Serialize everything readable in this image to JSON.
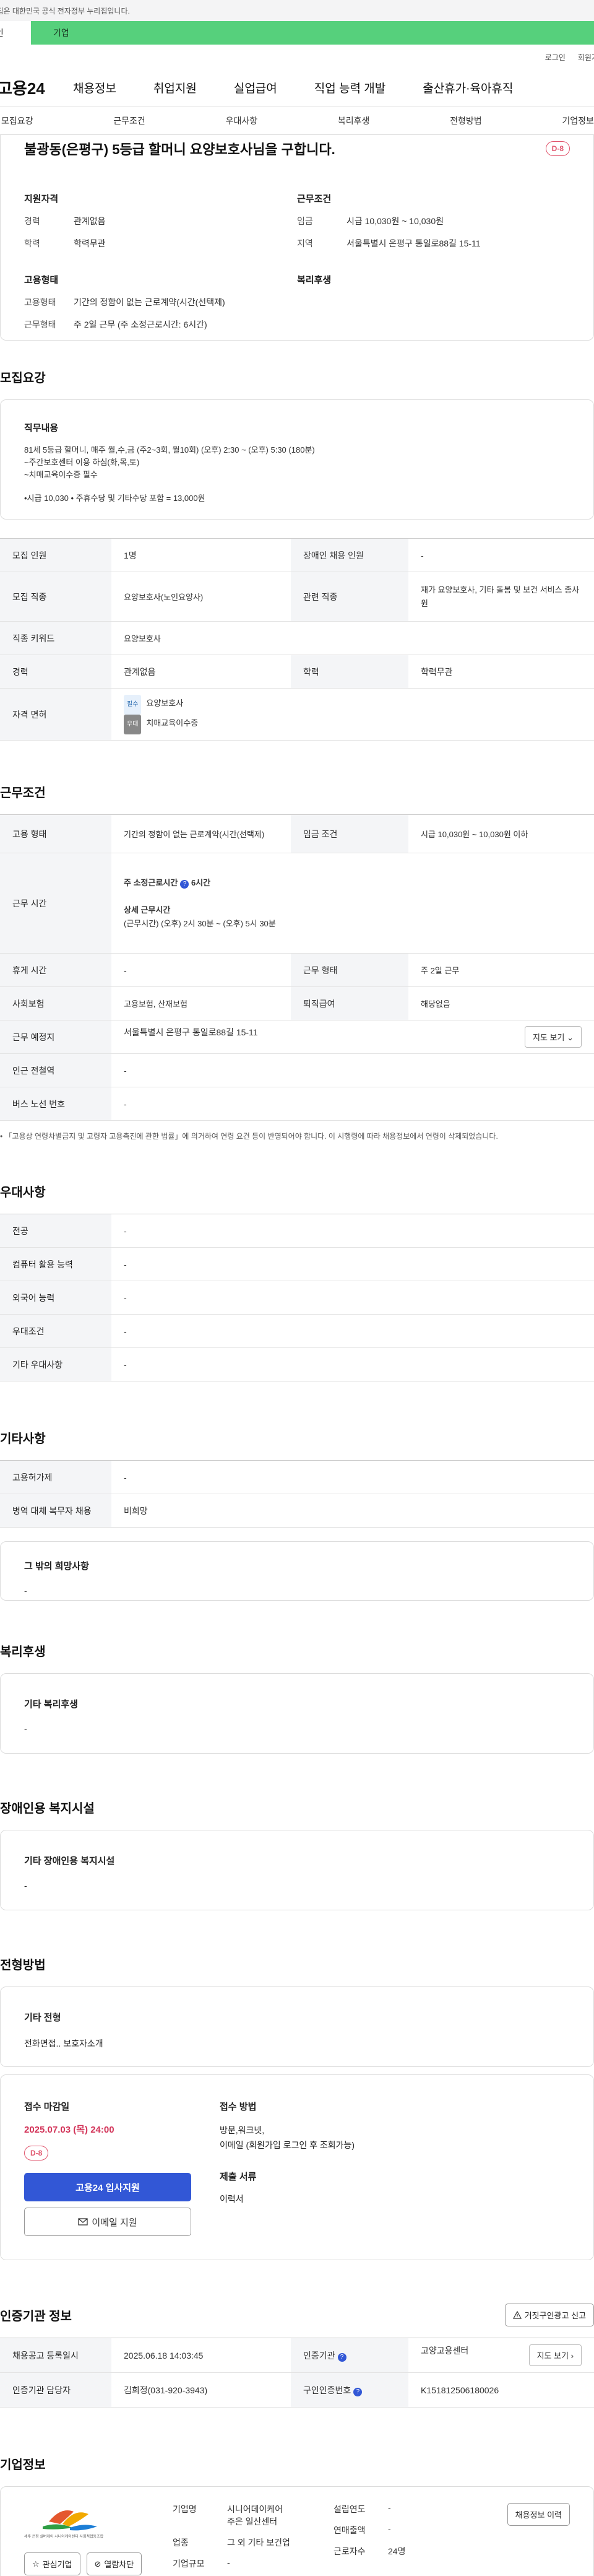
{
  "gov_banner": "이 누리집은 대한민국 공식 전자정부 누리집입니다.",
  "role_tabs": [
    "개인",
    "기업"
  ],
  "util_links": [
    "로그인",
    "회원가입"
  ],
  "logo": "고용24",
  "gnb": [
    "채용정보",
    "취업지원",
    "실업급여",
    "직업 능력 개발",
    "출산휴가·육아휴직"
  ],
  "subnav": [
    "모집요강",
    "근무조건",
    "우대사항",
    "복리후생",
    "전형방법",
    "기업정보"
  ],
  "summary": {
    "title": "불광동(은평구) 5등급 할머니 요양보호사님을 구합니다.",
    "dday": "D-8",
    "qual_h": "지원자격",
    "qual": [
      {
        "k": "경력",
        "v": "관계없음"
      },
      {
        "k": "학력",
        "v": "학력무관"
      }
    ],
    "cond_h": "근무조건",
    "cond": [
      {
        "k": "임금",
        "v": "시급 10,030원 ~ 10,030원"
      },
      {
        "k": "지역",
        "v": "서울특별시 은평구 통일로88길 15-11"
      }
    ],
    "form_h": "고용형태",
    "form": [
      {
        "k": "고용형태",
        "v": "기간의 정함이 없는 근로계약(시간(선택제)"
      },
      {
        "k": "근무형태",
        "v": "주 2일 근무 (주 소정근로시간: 6시간)"
      }
    ],
    "welfare_h": "복리후생"
  },
  "recruit": {
    "section": "모집요강",
    "duty_h": "직무내용",
    "duty_lines": [
      "81세 5등급 할머니, 매주 월,수,금 (주2~3회, 월10회) (오후) 2:30 ~ (오후) 5:30 (180분)",
      "~주간보호센터 이용 하심(화,목,토)",
      "~치매교육이수증 필수"
    ],
    "duty_pay": "•시급 10,030 • 주휴수당 및 기타수당 포함 = 13,000원",
    "rows": {
      "headcount_k": "모집 인원",
      "headcount_v": "1명",
      "disabled_k": "장애인 채용 인원",
      "disabled_v": "-",
      "job_k": "모집 직종",
      "job_v": "요양보호사(노인요양사)",
      "related_k": "관련 직종",
      "related_v": "재가 요양보호사, 기타 돌봄 및 보건 서비스 종사원",
      "keyword_k": "직종 키워드",
      "keyword_v": "요양보호사",
      "career_k": "경력",
      "career_v": "관계없음",
      "edu_k": "학력",
      "edu_v": "학력무관",
      "license_k": "자격 면허",
      "lic_req_badge": "필수",
      "lic_req": "요양보호사",
      "lic_pref_badge": "우대",
      "lic_pref": "치매교육이수증"
    }
  },
  "work": {
    "section": "근무조건",
    "type_k": "고용 형태",
    "type_v": "기간의 정함이 없는 근로계약(시간(선택제)",
    "wage_k": "임금 조건",
    "wage_v": "시급 10,030원 ~ 10,030원 이하",
    "hours_k": "근무 시간",
    "hours_week": "주 소정근로시간",
    "hours_week_v": "6시간",
    "hours_detail_h": "상세 근무시간",
    "hours_detail": "(근무시간) (오후) 2시 30분 ~ (오후) 5시 30분",
    "break_k": "휴게 시간",
    "break_v": "-",
    "form_k": "근무 형태",
    "form_v": "주 2일 근무",
    "insurance_k": "사회보험",
    "insurance_v": "고용보험, 산재보험",
    "retire_k": "퇴직급여",
    "retire_v": "해당없음",
    "place_k": "근무 예정지",
    "place_v": "서울특별시 은평구 통일로88길 15-11",
    "map_btn": "지도 보기",
    "subway_k": "인근 전철역",
    "subway_v": "-",
    "bus_k": "버스 노선 번호",
    "bus_v": "-",
    "note": "• 「고용상 연령차별금지 및 고령자 고용촉진에 관한 법률」에 의거하여 연령 요건 등이 반영되어야 합니다. 이 시행령에 따라 채용정보에서 연령이 삭제되었습니다."
  },
  "pref": {
    "section": "우대사항",
    "rows": [
      {
        "k": "전공",
        "v": "-"
      },
      {
        "k": "컴퓨터 활용 능력",
        "v": "-"
      },
      {
        "k": "외국어 능력",
        "v": "-"
      },
      {
        "k": "우대조건",
        "v": "-"
      },
      {
        "k": "기타 우대사항",
        "v": "-"
      }
    ]
  },
  "etc": {
    "section": "기타사항",
    "rows": [
      {
        "k": "고용허가제",
        "v": "-"
      },
      {
        "k": "병역 대체 복무자 채용",
        "v": "비희망"
      }
    ],
    "box_h": "그 밖의 희망사항",
    "box_v": "-"
  },
  "welfare": {
    "section": "복리후생",
    "box_h": "기타 복리후생",
    "box_v": "-"
  },
  "disabled_fac": {
    "section": "장애인용 복지시설",
    "box_h": "기타 장애인용 복지시설",
    "box_v": "-"
  },
  "screening": {
    "section": "전형방법",
    "box_h": "기타 전형",
    "box_v": "전화면접.. 보호자소개"
  },
  "apply": {
    "deadline_h": "접수 마감일",
    "deadline": "2025.07.03 (목) 24:00",
    "dday": "D-8",
    "btn_apply": "고용24 입사지원",
    "btn_email": "이메일 지원",
    "method_h": "접수 방법",
    "method_lines": [
      "방문,워크넷,",
      "이메일 (회원가입 로그인 후 조회가능)"
    ],
    "docs_h": "제출 서류",
    "docs_v": "이력서"
  },
  "certify": {
    "section": "인증기관 정보",
    "report_btn": "거짓구인광고 신고",
    "reg_k": "채용공고 등록일시",
    "reg_v": "2025.06.18 14:03:45",
    "agency_k": "인증기관",
    "agency_v": "고양고용센터",
    "map_btn": "지도 보기",
    "manager_k": "인증기관 담당자",
    "manager_v": "김희정(031-920-3943)",
    "no_k": "구인인증번호",
    "no_v": "K151812506180026"
  },
  "company": {
    "section": "기업정보",
    "logo_caption": "세주 은평 실버케어 시니어케어센터 사회적협동조합",
    "btn_fav": "관심기업",
    "btn_block": "열람차단",
    "btn_history": "채용정보 이력",
    "name_k": "기업명",
    "name_v1": "시니어데이케어",
    "name_v2": "주은 일산센터",
    "ind_k": "업종",
    "ind_v": "그 외 기타 보건업",
    "size_k": "기업규모",
    "size_v": "-",
    "year_k": "설립연도",
    "year_v": "-",
    "sales_k": "연매출액",
    "sales_v": "-",
    "emp_k": "근로자수",
    "emp_v": "24명"
  },
  "colors": {
    "accent": "#3257d6",
    "dday": "#e0546c",
    "role_tab": "#56d07c"
  }
}
